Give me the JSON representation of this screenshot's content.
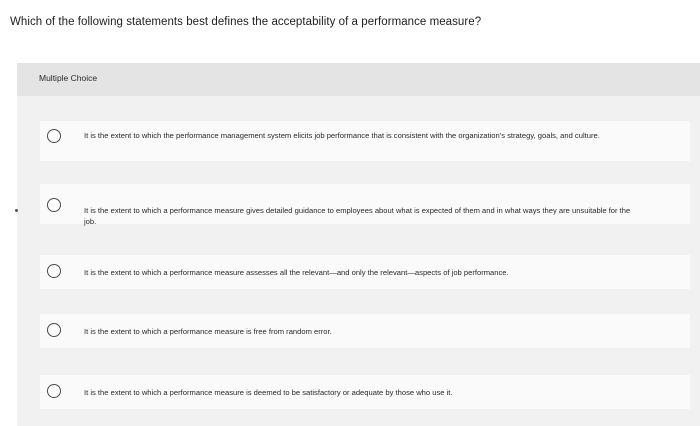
{
  "question": {
    "text": "Which of the following statements best defines the acceptability of a performance measure?"
  },
  "panel": {
    "label": "Multiple Choice"
  },
  "options": [
    {
      "text": "It is the extent to which the performance management system elicits job performance that is consistent with the organization's strategy, goals, and culture.",
      "selected": false
    },
    {
      "text": "It is the extent to which a performance measure gives detailed guidance to employees about what is expected of them and in what ways they are unsuitable for the job.",
      "selected": false
    },
    {
      "text": "It is the extent to which a performance measure assesses all the relevant—and only the relevant—aspects of job performance.",
      "selected": false
    },
    {
      "text": "It is the extent to which a performance measure is free from random error.",
      "selected": false
    },
    {
      "text": "It is the extent to which a performance measure is deemed to be satisfactory or adequate by those who use it.",
      "selected": false
    }
  ]
}
